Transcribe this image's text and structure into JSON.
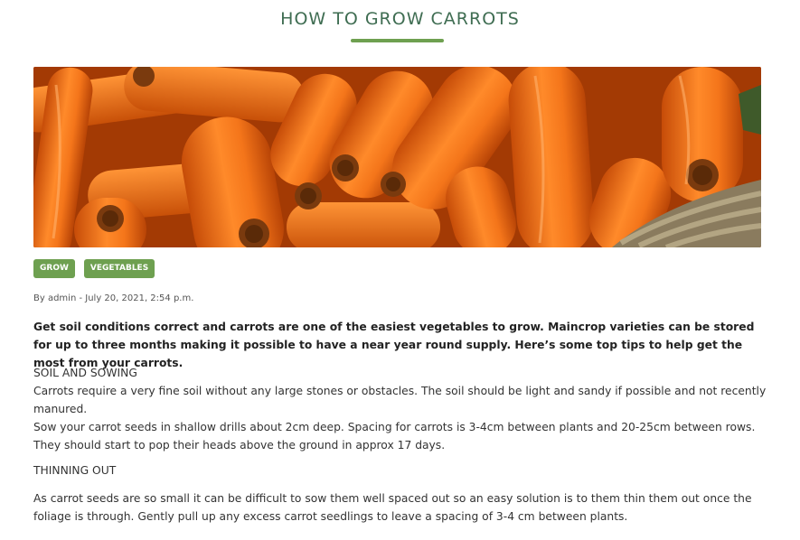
{
  "article": {
    "title": "HOW TO GROW CARROTS",
    "hero_image": "carrots-photo",
    "tags": [
      "GROW",
      "VEGETABLES"
    ],
    "meta": "By admin - July 20, 2021, 2:54 p.m.",
    "lead": "Get soil conditions correct and carrots are one of the easiest vegetables to grow. Maincrop varieties can be stored for up to three months making it possible to have a near year round supply. Here’s some top tips to help get the most from your carrots.",
    "sections": [
      {
        "heading": "SOIL AND SOWING",
        "lines": [
          "Carrots require a very fine soil without any large stones or obstacles. The soil should be light and sandy if possible and not recently manured.",
          "Sow your carrot seeds in shallow drills about 2cm deep. Spacing for carrots is 3-4cm between plants and 20-25cm between rows. They should start to pop their heads above the ground in approx 17 days."
        ]
      },
      {
        "heading": "THINNING OUT",
        "lines": [
          "As carrot seeds are so small it can be difficult to sow them well spaced out so an easy solution is to them thin them out once the foliage is through. Gently pull up any excess carrot seedlings to leave a spacing of 3-4 cm between plants."
        ]
      }
    ]
  },
  "colors": {
    "title": "#3f6d52",
    "accent": "#6ea050",
    "carrot": "#e86a10"
  }
}
